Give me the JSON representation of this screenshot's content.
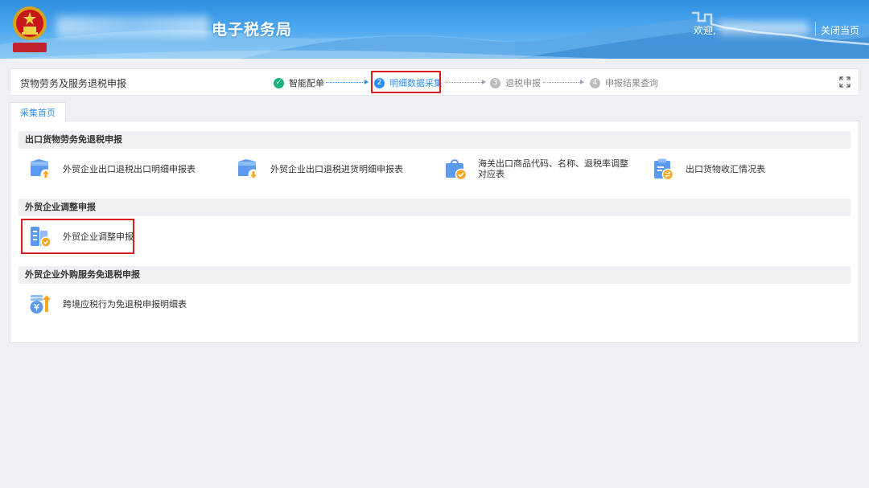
{
  "header": {
    "site_title": "电子税务局",
    "welcome_text": "欢迎,",
    "close_label": "关闭当页"
  },
  "stepbar": {
    "module_title": "货物劳务及服务退税申报",
    "steps": [
      {
        "num": "✓",
        "label": "智能配单",
        "state": "done"
      },
      {
        "num": "2",
        "label": "明细数据采集",
        "state": "active"
      },
      {
        "num": "3",
        "label": "退税申报",
        "state": "pending"
      },
      {
        "num": "4",
        "label": "申报结果查询",
        "state": "pending"
      }
    ]
  },
  "tab": {
    "label": "采集首页"
  },
  "sections": [
    {
      "title": "出口货物劳务免退税申报",
      "items": [
        {
          "label": "外贸企业出口退税出口明细申报表",
          "icon": "box-upload-icon"
        },
        {
          "label": "外贸企业出口退税进货明细申报表",
          "icon": "box-download-icon"
        },
        {
          "label": "海关出口商品代码、名称、退税率调整对应表",
          "icon": "shopping-bag-check-icon"
        },
        {
          "label": "出口货物收汇情况表",
          "icon": "clipboard-exchange-icon"
        }
      ]
    },
    {
      "title": "外贸企业调整申报",
      "items": [
        {
          "label": "外贸企业调整申报",
          "icon": "document-check-icon"
        }
      ]
    },
    {
      "title": "外贸企业外购服务免退税申报",
      "items": [
        {
          "label": "跨境应税行为免退税申报明细表",
          "icon": "coin-arrow-up-icon"
        }
      ]
    }
  ],
  "colors": {
    "primary": "#2e8ff0",
    "done": "#19b37b",
    "highlight": "#d81e1e",
    "icon_blue": "#5b9bef",
    "icon_orange": "#f5a623"
  }
}
